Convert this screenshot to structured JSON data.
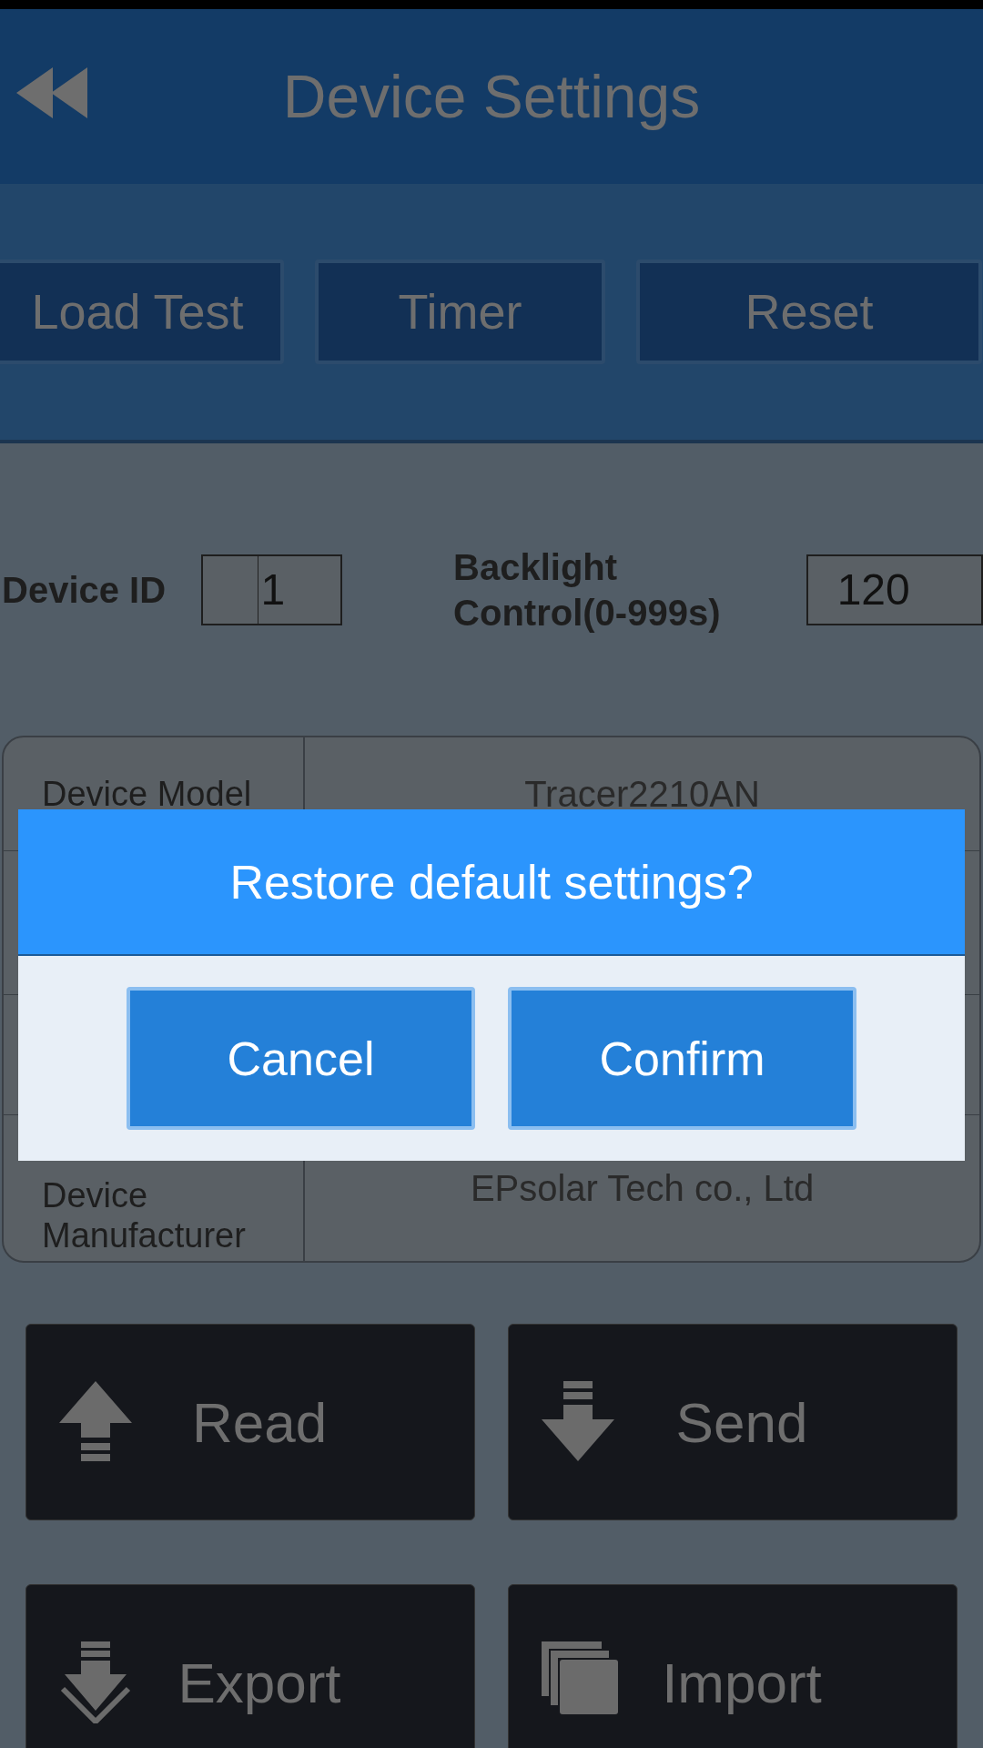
{
  "header": {
    "title": "Device Settings"
  },
  "tabs": [
    {
      "label": "Load Test"
    },
    {
      "label": "Timer"
    },
    {
      "label": "Reset"
    }
  ],
  "fields": [
    {
      "label": "Device ID",
      "value": "1"
    },
    {
      "label": "Backlight Control(0-999s)",
      "value": "120"
    }
  ],
  "info_table": [
    {
      "label": "Device Model",
      "value": "Tracer2210AN"
    },
    {
      "label": "Device Manufacturer",
      "value": "EPsolar Tech co., Ltd"
    }
  ],
  "actions": [
    {
      "label": "Read",
      "kind": "up"
    },
    {
      "label": "Send",
      "kind": "down"
    },
    {
      "label": "Export",
      "kind": "export"
    },
    {
      "label": "Import",
      "kind": "stack"
    }
  ],
  "dialog": {
    "message": "Restore default settings?",
    "buttons": [
      "Cancel",
      "Confirm"
    ]
  }
}
